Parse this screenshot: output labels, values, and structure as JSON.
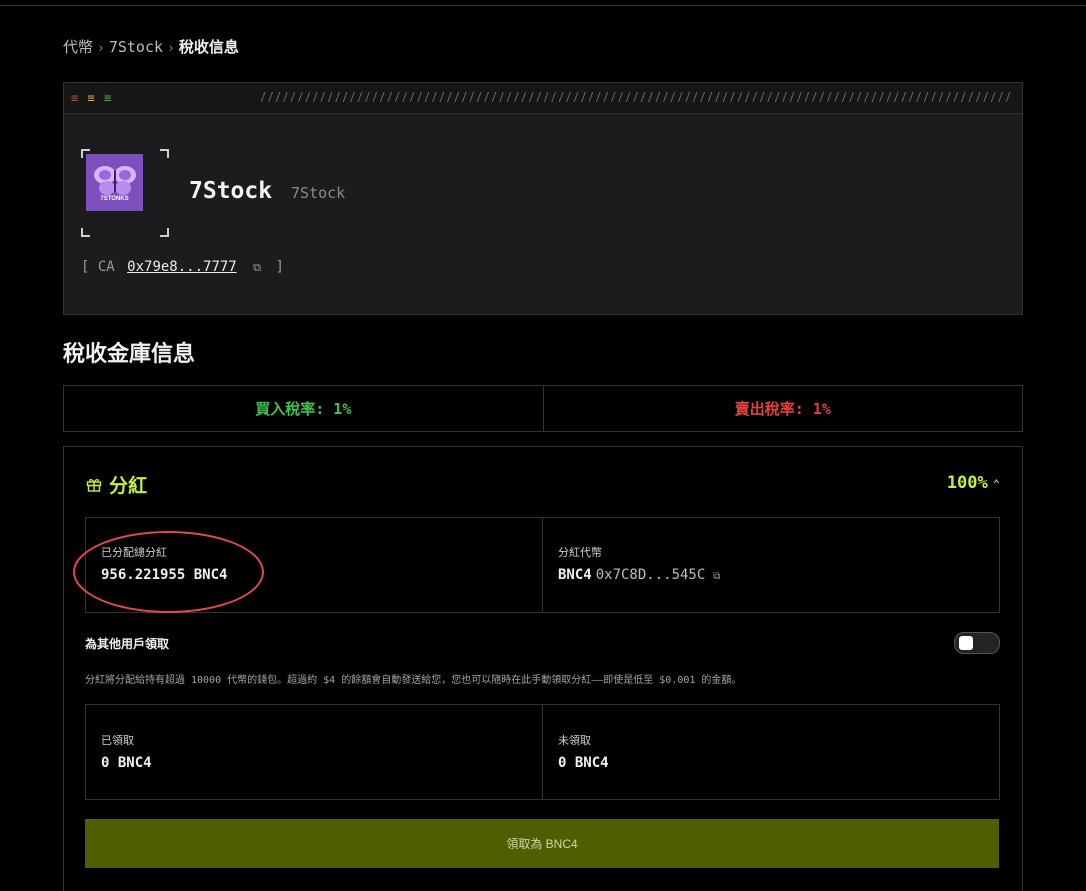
{
  "breadcrumb": {
    "items": [
      "代幣",
      "7Stock"
    ],
    "separator": "›",
    "current": "稅收信息"
  },
  "token": {
    "name": "7Stock",
    "symbol": "7Stock",
    "logo_text": "7STONKS",
    "ca_prefix": "[ CA",
    "ca_address": "0x79e8...7777",
    "ca_suffix": "]"
  },
  "treasury": {
    "title": "稅收金庫信息",
    "buy_tax": "買入稅率: 1%",
    "sell_tax": "賣出稅率: 1%"
  },
  "dividend": {
    "title": "分紅",
    "percent": "100%",
    "distributed_label": "已分配總分紅",
    "distributed_value": "956.221955 BNC4",
    "token_label": "分紅代幣",
    "token_symbol": "BNC4",
    "token_address": "0x7C8D...545C",
    "claim_for_others_label": "為其他用戶領取",
    "claim_for_others_enabled": false,
    "description": "分紅將分配給持有超過 10000 代幣的錢包。超過約 $4 的餘額會自動發送給您，您也可以隨時在此手動領取分紅——即使是低至 $0.001 的金額。",
    "claimed_label": "已領取",
    "claimed_value": "0 BNC4",
    "unclaimed_label": "未領取",
    "unclaimed_value": "0 BNC4",
    "claim_button": "領取為 BNC4"
  },
  "colors": {
    "accent": "#c5f03a",
    "buy": "#3fc24c",
    "sell": "#e0423b",
    "button_bg": "#4f5f00",
    "highlight": "#e4484f"
  },
  "icons": [
    "copy-icon",
    "gift-icon",
    "chevron-up-icon",
    "butterfly-logo"
  ]
}
